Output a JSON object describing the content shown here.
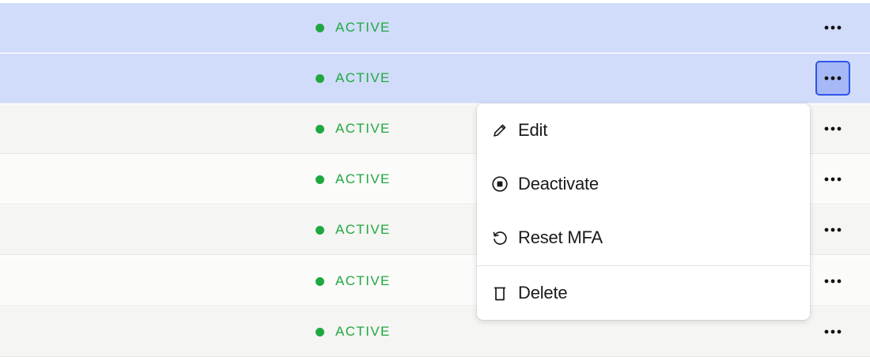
{
  "colors": {
    "status_active": "#1fa83f",
    "selected_row": "#d1dcfa",
    "accent": "#2f55e8"
  },
  "rows": [
    {
      "status": "ACTIVE",
      "selected": true
    },
    {
      "status": "ACTIVE",
      "selected": true
    },
    {
      "status": "ACTIVE",
      "selected": false
    },
    {
      "status": "ACTIVE",
      "selected": false
    },
    {
      "status": "ACTIVE",
      "selected": false
    },
    {
      "status": "ACTIVE",
      "selected": false
    },
    {
      "status": "ACTIVE",
      "selected": false
    }
  ],
  "row_actions_icon": "more-horizontal-icon",
  "context_menu": {
    "items": [
      {
        "label": "Edit",
        "icon": "pencil-icon"
      },
      {
        "label": "Deactivate",
        "icon": "stop-circle-icon"
      },
      {
        "label": "Reset MFA",
        "icon": "rotate-ccw-icon"
      },
      {
        "label": "Delete",
        "icon": "trash-icon"
      }
    ]
  }
}
